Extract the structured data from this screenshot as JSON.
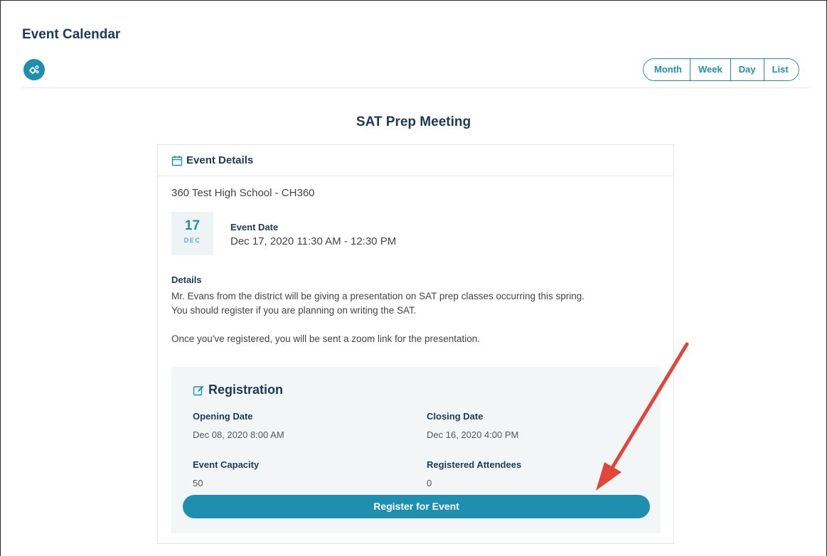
{
  "page": {
    "title": "Event Calendar"
  },
  "toolbar": {
    "settings_icon": "gears-icon",
    "views": [
      "Month",
      "Week",
      "Day",
      "List"
    ]
  },
  "event": {
    "title": "SAT Prep Meeting",
    "card_header": "Event Details",
    "location": "360 Test High School - CH360",
    "date_badge": {
      "day": "17",
      "month": "DEC"
    },
    "date_label": "Event Date",
    "date_value": "Dec 17, 2020 11:30 AM - 12:30 PM",
    "details_label": "Details",
    "details_lines": [
      "Mr. Evans from the district will be giving a presentation on SAT prep classes occurring this spring.",
      "You should register if you are planning on writing the SAT.",
      "Once you've registered, you will be sent a zoom link for the presentation."
    ]
  },
  "registration": {
    "title": "Registration",
    "opening_label": "Opening Date",
    "opening_value": "Dec 08, 2020 8:00 AM",
    "closing_label": "Closing Date",
    "closing_value": "Dec 16, 2020 4:00 PM",
    "capacity_label": "Event Capacity",
    "capacity_value": "50",
    "attendees_label": "Registered Attendees",
    "attendees_value": "0",
    "button_label": "Register for Event"
  },
  "colors": {
    "accent": "#1e8fae",
    "heading": "#1b3a57",
    "annotation_arrow": "#e2463a"
  }
}
